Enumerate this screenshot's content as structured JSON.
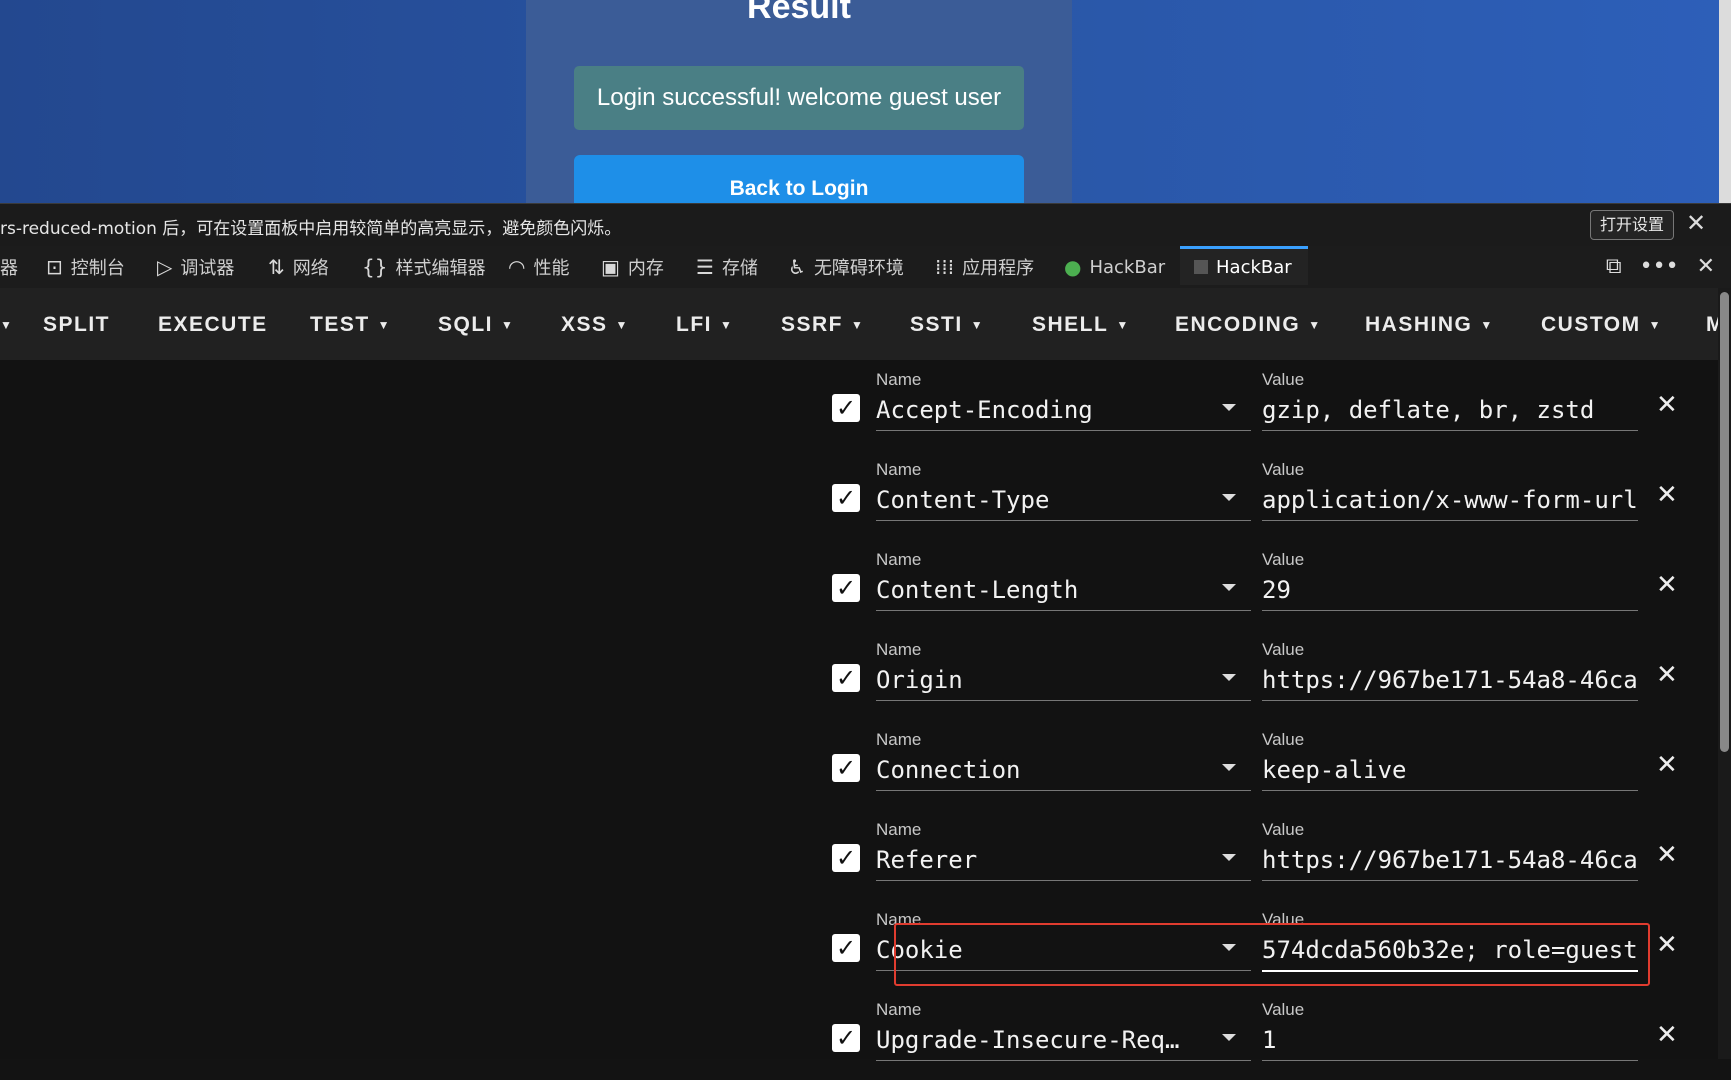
{
  "page": {
    "title": "Result",
    "message": "Login successful! welcome guest user",
    "back_button": "Back to Login"
  },
  "notice": {
    "text": "rs-reduced-motion 后，可在设置面板中启用较简单的高亮显示，避免颜色闪烁。",
    "button": "打开设置"
  },
  "devtools_tabs": [
    {
      "label": "器",
      "icon": "inspector-icon"
    },
    {
      "label": "控制台",
      "icon": "console-icon"
    },
    {
      "label": "调试器",
      "icon": "debugger-icon"
    },
    {
      "label": "网络",
      "icon": "network-icon"
    },
    {
      "label": "样式编辑器",
      "icon": "style-editor-icon"
    },
    {
      "label": "性能",
      "icon": "performance-icon"
    },
    {
      "label": "内存",
      "icon": "memory-icon"
    },
    {
      "label": "存储",
      "icon": "storage-icon"
    },
    {
      "label": "无障碍环境",
      "icon": "accessibility-icon"
    },
    {
      "label": "应用程序",
      "icon": "application-icon"
    },
    {
      "label": "HackBar",
      "icon": "hackbar-green-icon"
    },
    {
      "label": "HackBar",
      "icon": "hackbar-dark-icon",
      "active": true
    }
  ],
  "menu": [
    "SPLIT",
    "EXECUTE",
    "TEST",
    "SQLI",
    "XSS",
    "LFI",
    "SSRF",
    "SSTI",
    "SHELL",
    "ENCODING",
    "HASHING",
    "CUSTOM",
    "M"
  ],
  "labels": {
    "name": "Name",
    "value": "Value"
  },
  "headers": [
    {
      "name": "Accept-Encoding",
      "value": "gzip, deflate, br, zstd",
      "checked": true
    },
    {
      "name": "Content-Type",
      "value": "application/x-www-form-url",
      "checked": true
    },
    {
      "name": "Content-Length",
      "value": "29",
      "checked": true
    },
    {
      "name": "Origin",
      "value": "https://967be171-54a8-46ca",
      "checked": true
    },
    {
      "name": "Connection",
      "value": "keep-alive",
      "checked": true
    },
    {
      "name": "Referer",
      "value": "https://967be171-54a8-46ca",
      "checked": true
    },
    {
      "name": "Cookie",
      "value": "574dcda560b32e; role=guest",
      "checked": true
    },
    {
      "name": "Upgrade-Insecure-Req…",
      "value": "1",
      "checked": true
    }
  ],
  "colors": {
    "accent": "#3aa0ff",
    "highlight": "#e03c2f",
    "success": "#4a7f85",
    "button": "#1e8fe8"
  }
}
